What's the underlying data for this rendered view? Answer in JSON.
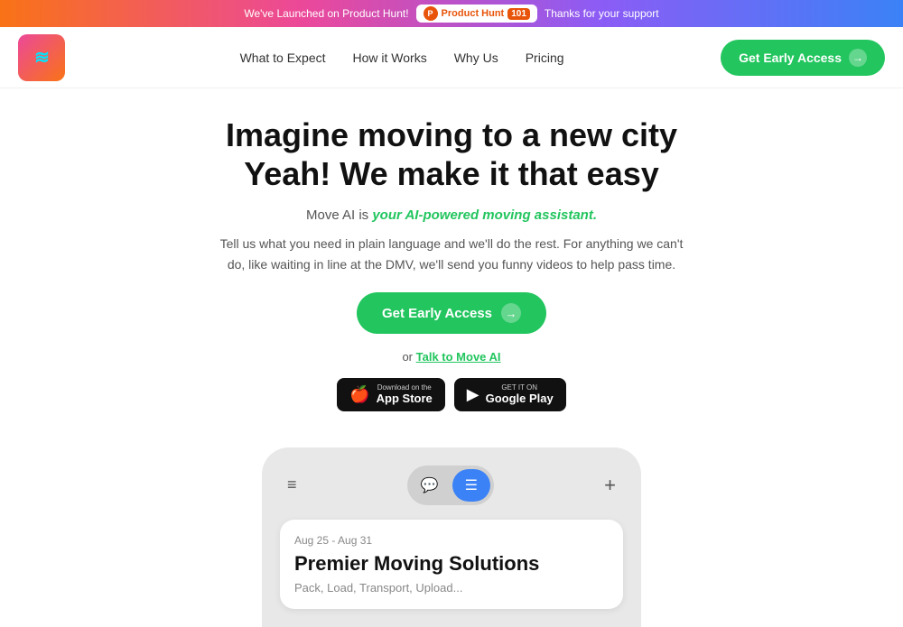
{
  "banner": {
    "text_before": "We've Launched on Product Hunt!",
    "link_text": "Product Hunt",
    "text_after": "Thanks for your support",
    "badge_label": "Product Hunt",
    "badge_count": "101"
  },
  "nav": {
    "logo_text": "≋",
    "links": [
      {
        "label": "What to Expect",
        "id": "what-to-expect"
      },
      {
        "label": "How it Works",
        "id": "how-it-works"
      },
      {
        "label": "Why Us",
        "id": "why-us"
      },
      {
        "label": "Pricing",
        "id": "pricing"
      }
    ],
    "cta_label": "Get Early Access"
  },
  "hero": {
    "heading_line1": "Imagine moving to a new city",
    "heading_line2": "Yeah! We make it that easy",
    "subtitle_plain": "Move AI is ",
    "subtitle_highlight": "your AI-powered moving assistant.",
    "description": "Tell us what you need in plain language and we'll do the rest. For anything we can't do, like waiting in line at the DMV, we'll send you funny videos to help pass time.",
    "cta_label": "Get Early Access",
    "or_text": "or",
    "talk_link": "Talk to Move AI",
    "app_store_small": "Download on the",
    "app_store_big": "App Store",
    "google_play_small": "GET IT ON",
    "google_play_big": "Google Play"
  },
  "phone": {
    "toolbar": {
      "menu_icon": "≡",
      "chat_icon": "💬",
      "list_icon": "☰",
      "plus_icon": "+"
    },
    "card": {
      "date": "Aug 25 - Aug 31",
      "title": "Premier Moving Solutions",
      "tags": "Pack, Load, Transport, Upload..."
    }
  }
}
